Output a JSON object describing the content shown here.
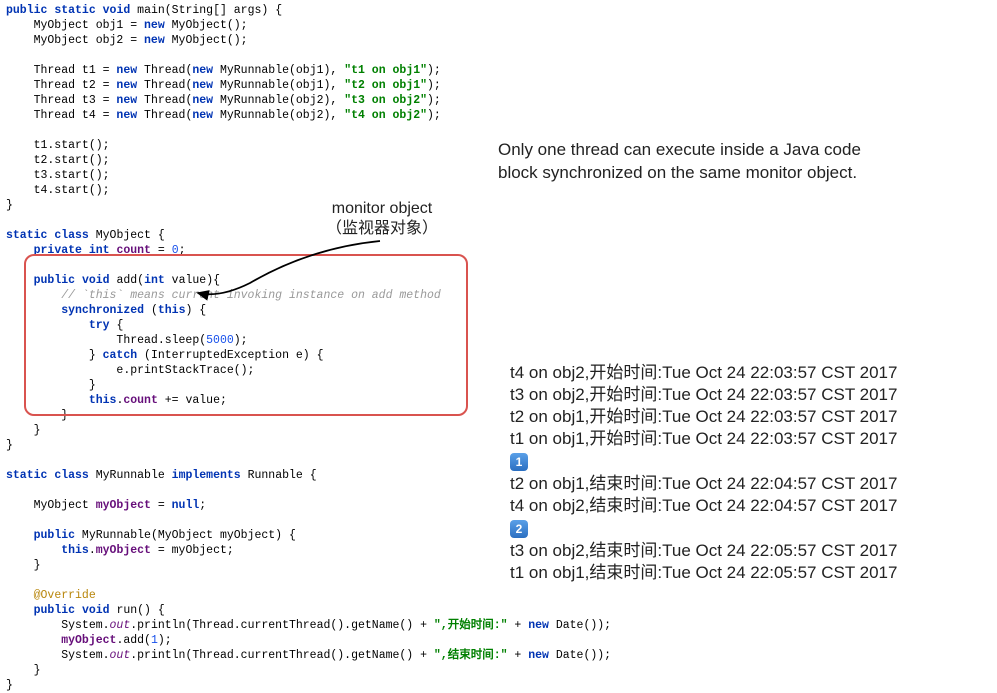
{
  "code": {
    "l1a": "public",
    "l1b": "static",
    "l1c": "void",
    "l1d": " main(String[] args) {",
    "l2a": "    MyObject obj1 = ",
    "l2b": "new",
    "l2c": " MyObject();",
    "l3a": "    MyObject obj2 = ",
    "l3b": "new",
    "l3c": " MyObject();",
    "l5a": "    Thread t1 = ",
    "l5b": "new",
    "l5c": " Thread(",
    "l5d": "new",
    "l5e": " MyRunnable(obj1), ",
    "l5f": "\"t1 on obj1\"",
    "l5g": ");",
    "l6a": "    Thread t2 = ",
    "l6b": "new",
    "l6c": " Thread(",
    "l6d": "new",
    "l6e": " MyRunnable(obj1), ",
    "l6f": "\"t2 on obj1\"",
    "l6g": ");",
    "l7a": "    Thread t3 = ",
    "l7b": "new",
    "l7c": " Thread(",
    "l7d": "new",
    "l7e": " MyRunnable(obj2), ",
    "l7f": "\"t3 on obj2\"",
    "l7g": ");",
    "l8a": "    Thread t4 = ",
    "l8b": "new",
    "l8c": " Thread(",
    "l8d": "new",
    "l8e": " MyRunnable(obj2), ",
    "l8f": "\"t4 on obj2\"",
    "l8g": ");",
    "l10": "    t1.start();",
    "l11": "    t2.start();",
    "l12": "    t3.start();",
    "l13": "    t4.start();",
    "l14": "}",
    "l16a": "static",
    "l16b": "class",
    "l16c": " MyObject {",
    "l17a": "    ",
    "l17b": "private",
    "l17c": "int",
    "l17d": "count",
    "l17e": " = ",
    "l17f": "0",
    "l17g": ";",
    "l19a": "    ",
    "l19b": "public",
    "l19c": "void",
    "l19d": " add(",
    "l19e": "int",
    "l19f": " value){",
    "l20a": "        ",
    "l20b": "// `this` means current invoking instance on add method",
    "l21a": "        ",
    "l21b": "synchronized",
    "l21c": " (",
    "l21d": "this",
    "l21e": ") {",
    "l22a": "            ",
    "l22b": "try",
    "l22c": " {",
    "l23a": "                Thread.sleep(",
    "l23b": "5000",
    "l23c": ");",
    "l24a": "            } ",
    "l24b": "catch",
    "l24c": " (InterruptedException e) {",
    "l25": "                e.printStackTrace();",
    "l26": "            }",
    "l27a": "            ",
    "l27b": "this",
    "l27c": ".",
    "l27d": "count",
    "l27e": " += value;",
    "l28": "        }",
    "l29": "    }",
    "l30": "}",
    "l32a": "static",
    "l32b": "class",
    "l32c": " MyRunnable ",
    "l32d": "implements",
    "l32e": " Runnable {",
    "l34a": "    MyObject ",
    "l34b": "myObject",
    "l34c": " = ",
    "l34d": "null",
    "l34e": ";",
    "l36a": "    ",
    "l36b": "public",
    "l36c": " MyRunnable(MyObject myObject) {",
    "l37a": "        ",
    "l37b": "this",
    "l37c": ".",
    "l37d": "myObject",
    "l37e": " = myObject;",
    "l38": "    }",
    "l40a": "    ",
    "l40b": "@Override",
    "l41a": "    ",
    "l41b": "public",
    "l41c": "void",
    "l41d": " run() {",
    "l42a": "        System.",
    "l42b": "out",
    "l42c": ".println(Thread.currentThread().getName() + ",
    "l42d": "\",开始时间:\"",
    "l42e": " + ",
    "l42f": "new",
    "l42g": " Date());",
    "l43a": "        ",
    "l43b": "myObject",
    "l43c": ".add(",
    "l43d": "1",
    "l43e": ");",
    "l44a": "        System.",
    "l44b": "out",
    "l44c": ".println(Thread.currentThread().getName() + ",
    "l44d": "\",结束时间:\"",
    "l44e": " + ",
    "l44f": "new",
    "l44g": " Date());",
    "l45": "    }",
    "l46": "}"
  },
  "annotation": {
    "line1": "monitor object",
    "line2": "（监视器对象）"
  },
  "explain": {
    "line1": "Only one thread can execute inside a Java code",
    "line2": "block synchronized on the same monitor object."
  },
  "output": {
    "r1": "t4 on obj2,开始时间:Tue Oct 24 22:03:57 CST 2017",
    "r2": "t3 on obj2,开始时间:Tue Oct 24 22:03:57 CST 2017",
    "r3": "t2 on obj1,开始时间:Tue Oct 24 22:03:57 CST 2017",
    "r4": "t1 on obj1,开始时间:Tue Oct 24 22:03:57 CST 2017",
    "badge1": "1",
    "r5": "t2 on obj1,结束时间:Tue Oct 24 22:04:57 CST 2017",
    "r6": "t4 on obj2,结束时间:Tue Oct 24 22:04:57 CST 2017",
    "badge2": "2",
    "r7": "t3 on obj2,结束时间:Tue Oct 24 22:05:57 CST 2017",
    "r8": "t1 on obj1,结束时间:Tue Oct 24 22:05:57 CST 2017"
  }
}
